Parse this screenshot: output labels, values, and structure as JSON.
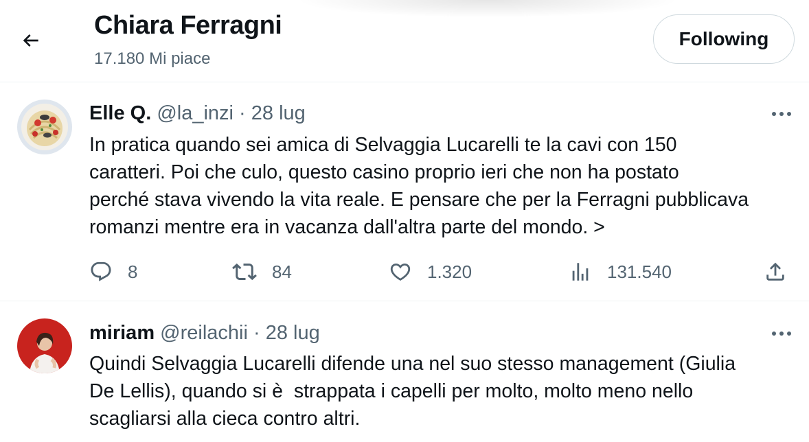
{
  "header": {
    "title": "Chiara Ferragni",
    "subtitle": "17.180 Mi piace",
    "follow_label": "Following"
  },
  "tweets": [
    {
      "name": "Elle Q.",
      "handle": "@la_inzi",
      "separator": "·",
      "date": "28 lug",
      "text": "In pratica quando sei amica di Selvaggia Lucarelli te la cavi con 150\ncaratteri. Poi che culo, questo casino proprio ieri che non ha postato\nperché stava vivendo la vita reale. E pensare che per la Ferragni pubblicava\nromanzi mentre era in vacanza dall'altra parte del mondo. >",
      "replies": "8",
      "retweets": "84",
      "likes": "1.320",
      "views": "131.540"
    },
    {
      "name": "miriam",
      "handle": "@reilachii",
      "separator": "·",
      "date": "28 lug",
      "text": "Quindi Selvaggia Lucarelli difende una nel suo stesso management (Giulia\nDe Lellis), quando si è  strappata i capelli per molto, molto meno nello\nscagliarsi alla cieca contro altri."
    }
  ],
  "icons": {
    "back": "arrow-left-icon",
    "more": "more-horizontal-icon",
    "reply": "reply-icon",
    "retweet": "retweet-icon",
    "like": "heart-icon",
    "views": "views-icon",
    "share": "share-icon"
  },
  "colors": {
    "text_primary": "#0f1419",
    "text_secondary": "#536471",
    "border": "#eff3f4"
  }
}
